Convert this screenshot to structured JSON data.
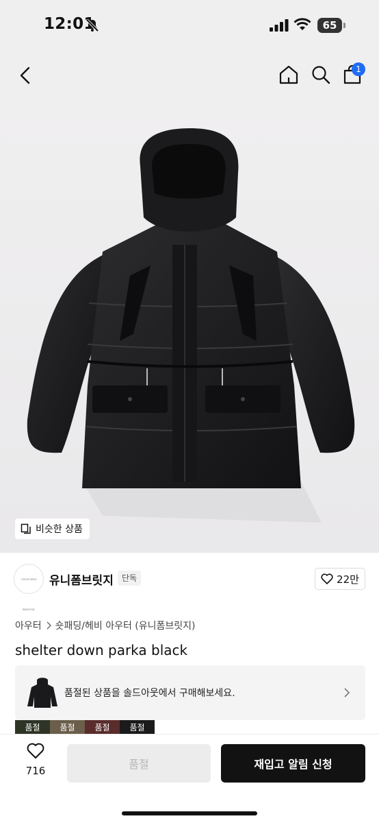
{
  "status_bar": {
    "time": "12:01",
    "battery": "65"
  },
  "nav": {
    "cart_count": "1"
  },
  "hero": {
    "similar_label": "비슷한 상품"
  },
  "brand": {
    "name": "유니폼브릿지",
    "tag": "단독",
    "logo_text": "UNIFORM BRIDGE",
    "likes": "22만"
  },
  "product": {
    "category_parent": "아우터",
    "category_path": "숏패딩/헤비 아우터 (유니폼브릿지)",
    "title": "shelter down parka black"
  },
  "soldout_notice": {
    "text": "품절된 상품을 솔드아웃에서 구매해보세요."
  },
  "swatches": [
    {
      "label": "품절",
      "color": "#2f3526"
    },
    {
      "label": "품절",
      "color": "#6b5f4c"
    },
    {
      "label": "품절",
      "color": "#5a2c2c"
    },
    {
      "label": "품절",
      "color": "#1b1b1b"
    }
  ],
  "bottom_bar": {
    "wish_count": "716",
    "soldout_label": "품절",
    "restock_label": "재입고 알림 신청"
  },
  "colors": {
    "accent_badge": "#1f6cf4",
    "primary_button": "#121212"
  },
  "icons": [
    "bell-slash-icon",
    "signal-icon",
    "wifi-icon",
    "back-icon",
    "home-icon",
    "search-icon",
    "shopping-bag-icon",
    "copy-icon",
    "heart-icon",
    "chevron-right-icon"
  ]
}
